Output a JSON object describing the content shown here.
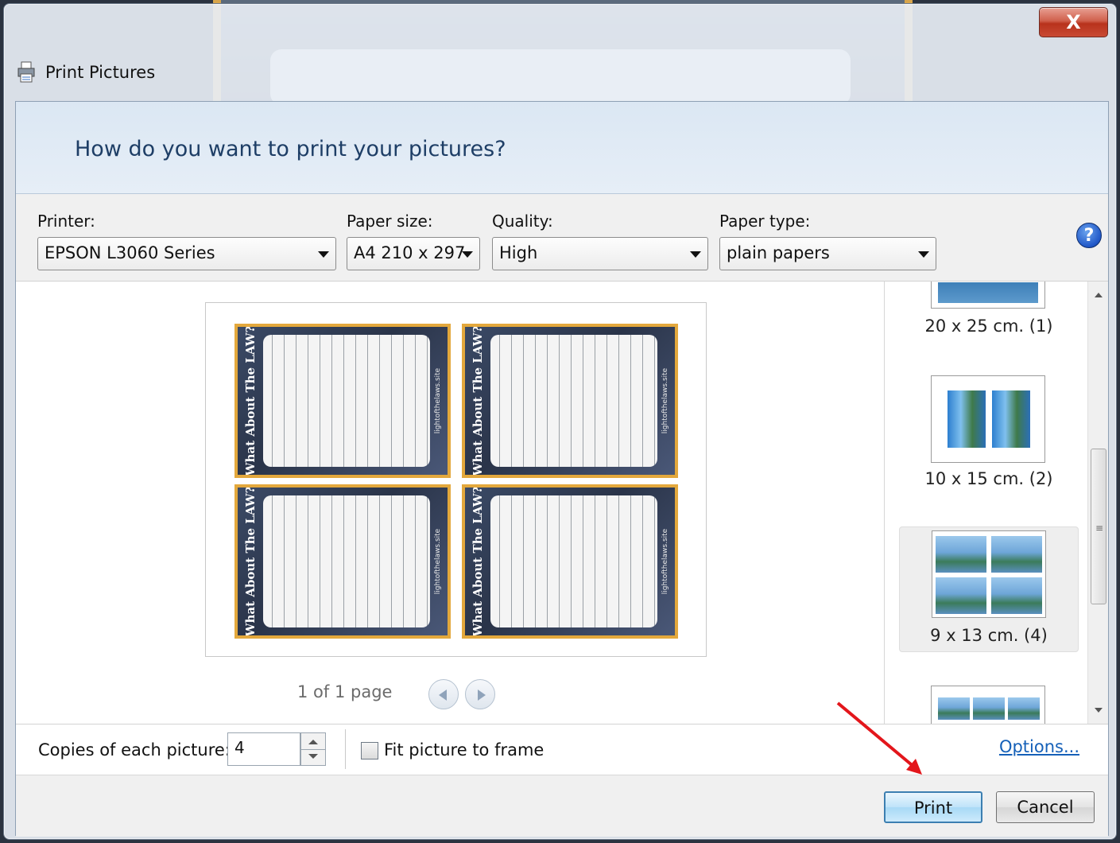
{
  "window": {
    "title": "Print Pictures",
    "close_label": "X",
    "heading": "How do you want to print your pictures?"
  },
  "options": {
    "printer": {
      "label": "Printer:",
      "value": "EPSON L3060 Series"
    },
    "paper_size": {
      "label": "Paper size:",
      "value": "A4 210 x 297"
    },
    "quality": {
      "label": "Quality:",
      "value": "High"
    },
    "paper_type": {
      "label": "Paper type:",
      "value": "plain papers"
    },
    "help_icon_glyph": "?"
  },
  "preview": {
    "page_indicator": "1 of 1 page",
    "cards": [
      {
        "title": "What About The LAW?",
        "site": "lightofthelaws.site"
      },
      {
        "title": "What About The LAW?",
        "site": "lightofthelaws.site"
      },
      {
        "title": "What About The LAW?",
        "site": "lightofthelaws.site"
      },
      {
        "title": "What About The LAW?",
        "site": "lightofthelaws.site"
      }
    ]
  },
  "layouts": {
    "items": [
      {
        "label": "20 x 25 cm. (1)"
      },
      {
        "label": "10 x 15 cm. (2)"
      },
      {
        "label": "9 x 13 cm. (4)",
        "selected": true
      },
      {
        "label": ""
      }
    ],
    "scroll_grip": "≡"
  },
  "copies": {
    "label": "Copies of each picture:",
    "value": "4",
    "fit_label": "Fit picture to frame",
    "fit_checked": false,
    "options_link": "Options..."
  },
  "buttons": {
    "print": "Print",
    "cancel": "Cancel"
  },
  "colors": {
    "accent": "#3c7fb1",
    "heading": "#1e3e66",
    "annotation_arrow": "#e3161b",
    "card_border": "#e3a83c"
  }
}
